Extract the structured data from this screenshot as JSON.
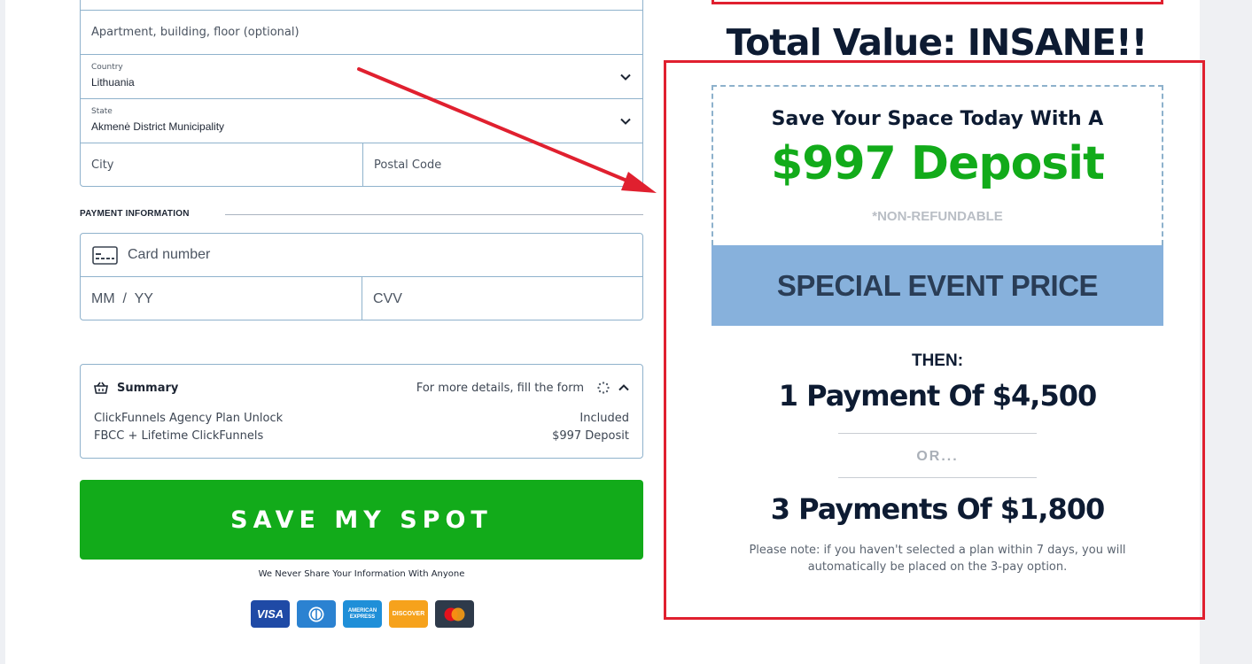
{
  "address": {
    "apartment_placeholder": "Apartment, building, floor (optional)",
    "country_label": "Country",
    "country_value": "Lithuania",
    "state_label": "State",
    "state_value": "Akmenė District Municipality",
    "city_placeholder": "City",
    "postal_placeholder": "Postal Code"
  },
  "payment": {
    "section_title": "PAYMENT INFORMATION",
    "card_placeholder": "Card number",
    "expiry_placeholder": "MM  /  YY",
    "cvv_placeholder": "CVV"
  },
  "summary": {
    "title": "Summary",
    "hint": "For more details, fill the form",
    "items": [
      {
        "label": "ClickFunnels Agency Plan Unlock",
        "value": "Included"
      },
      {
        "label": "FBCC + Lifetime ClickFunnels",
        "value": "$997 Deposit"
      }
    ]
  },
  "cta": {
    "label": "SAVE MY SPOT",
    "privacy": "We Never Share Your Information With Anyone"
  },
  "card_brands": [
    "VISA",
    "Diners Club",
    "AMERICAN EXPRESS",
    "DISCOVER",
    "Mastercard"
  ],
  "offer": {
    "total_value": "Total Value: INSANE!!",
    "save_line": "Save Your Space Today With A",
    "deposit": "$997 Deposit",
    "non_refundable": "*NON-REFUNDABLE",
    "special": "SPECIAL EVENT PRICE",
    "then": "THEN:",
    "payment_one": "1 Payment Of $4,500",
    "or": "OR...",
    "payment_three": "3 Payments Of $1,800",
    "note": "Please note: if you haven't selected a plan within 7 days, you will automatically be placed on the 3-pay option."
  },
  "colors": {
    "accent_green": "#12ab1a",
    "accent_red": "#e0202f",
    "special_blue": "#87b1dc",
    "field_border": "#8fb2cc"
  }
}
